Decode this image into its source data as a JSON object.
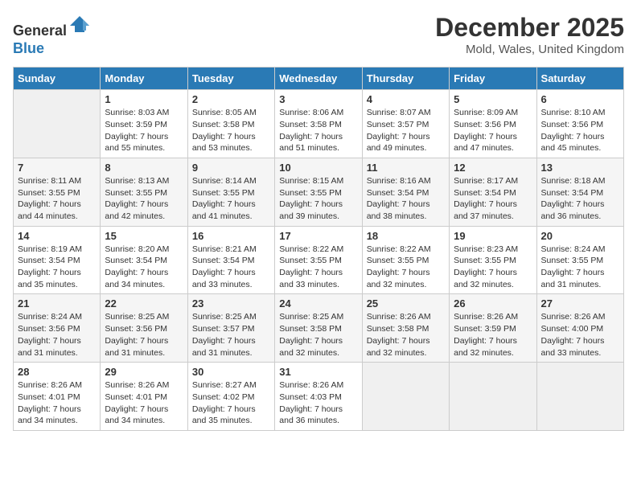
{
  "logo": {
    "general": "General",
    "blue": "Blue"
  },
  "header": {
    "month": "December 2025",
    "location": "Mold, Wales, United Kingdom"
  },
  "days_of_week": [
    "Sunday",
    "Monday",
    "Tuesday",
    "Wednesday",
    "Thursday",
    "Friday",
    "Saturday"
  ],
  "weeks": [
    [
      {
        "day": "",
        "info": ""
      },
      {
        "day": "1",
        "info": "Sunrise: 8:03 AM\nSunset: 3:59 PM\nDaylight: 7 hours\nand 55 minutes."
      },
      {
        "day": "2",
        "info": "Sunrise: 8:05 AM\nSunset: 3:58 PM\nDaylight: 7 hours\nand 53 minutes."
      },
      {
        "day": "3",
        "info": "Sunrise: 8:06 AM\nSunset: 3:58 PM\nDaylight: 7 hours\nand 51 minutes."
      },
      {
        "day": "4",
        "info": "Sunrise: 8:07 AM\nSunset: 3:57 PM\nDaylight: 7 hours\nand 49 minutes."
      },
      {
        "day": "5",
        "info": "Sunrise: 8:09 AM\nSunset: 3:56 PM\nDaylight: 7 hours\nand 47 minutes."
      },
      {
        "day": "6",
        "info": "Sunrise: 8:10 AM\nSunset: 3:56 PM\nDaylight: 7 hours\nand 45 minutes."
      }
    ],
    [
      {
        "day": "7",
        "info": "Sunrise: 8:11 AM\nSunset: 3:55 PM\nDaylight: 7 hours\nand 44 minutes."
      },
      {
        "day": "8",
        "info": "Sunrise: 8:13 AM\nSunset: 3:55 PM\nDaylight: 7 hours\nand 42 minutes."
      },
      {
        "day": "9",
        "info": "Sunrise: 8:14 AM\nSunset: 3:55 PM\nDaylight: 7 hours\nand 41 minutes."
      },
      {
        "day": "10",
        "info": "Sunrise: 8:15 AM\nSunset: 3:55 PM\nDaylight: 7 hours\nand 39 minutes."
      },
      {
        "day": "11",
        "info": "Sunrise: 8:16 AM\nSunset: 3:54 PM\nDaylight: 7 hours\nand 38 minutes."
      },
      {
        "day": "12",
        "info": "Sunrise: 8:17 AM\nSunset: 3:54 PM\nDaylight: 7 hours\nand 37 minutes."
      },
      {
        "day": "13",
        "info": "Sunrise: 8:18 AM\nSunset: 3:54 PM\nDaylight: 7 hours\nand 36 minutes."
      }
    ],
    [
      {
        "day": "14",
        "info": "Sunrise: 8:19 AM\nSunset: 3:54 PM\nDaylight: 7 hours\nand 35 minutes."
      },
      {
        "day": "15",
        "info": "Sunrise: 8:20 AM\nSunset: 3:54 PM\nDaylight: 7 hours\nand 34 minutes."
      },
      {
        "day": "16",
        "info": "Sunrise: 8:21 AM\nSunset: 3:54 PM\nDaylight: 7 hours\nand 33 minutes."
      },
      {
        "day": "17",
        "info": "Sunrise: 8:22 AM\nSunset: 3:55 PM\nDaylight: 7 hours\nand 33 minutes."
      },
      {
        "day": "18",
        "info": "Sunrise: 8:22 AM\nSunset: 3:55 PM\nDaylight: 7 hours\nand 32 minutes."
      },
      {
        "day": "19",
        "info": "Sunrise: 8:23 AM\nSunset: 3:55 PM\nDaylight: 7 hours\nand 32 minutes."
      },
      {
        "day": "20",
        "info": "Sunrise: 8:24 AM\nSunset: 3:55 PM\nDaylight: 7 hours\nand 31 minutes."
      }
    ],
    [
      {
        "day": "21",
        "info": "Sunrise: 8:24 AM\nSunset: 3:56 PM\nDaylight: 7 hours\nand 31 minutes."
      },
      {
        "day": "22",
        "info": "Sunrise: 8:25 AM\nSunset: 3:56 PM\nDaylight: 7 hours\nand 31 minutes."
      },
      {
        "day": "23",
        "info": "Sunrise: 8:25 AM\nSunset: 3:57 PM\nDaylight: 7 hours\nand 31 minutes."
      },
      {
        "day": "24",
        "info": "Sunrise: 8:25 AM\nSunset: 3:58 PM\nDaylight: 7 hours\nand 32 minutes."
      },
      {
        "day": "25",
        "info": "Sunrise: 8:26 AM\nSunset: 3:58 PM\nDaylight: 7 hours\nand 32 minutes."
      },
      {
        "day": "26",
        "info": "Sunrise: 8:26 AM\nSunset: 3:59 PM\nDaylight: 7 hours\nand 32 minutes."
      },
      {
        "day": "27",
        "info": "Sunrise: 8:26 AM\nSunset: 4:00 PM\nDaylight: 7 hours\nand 33 minutes."
      }
    ],
    [
      {
        "day": "28",
        "info": "Sunrise: 8:26 AM\nSunset: 4:01 PM\nDaylight: 7 hours\nand 34 minutes."
      },
      {
        "day": "29",
        "info": "Sunrise: 8:26 AM\nSunset: 4:01 PM\nDaylight: 7 hours\nand 34 minutes."
      },
      {
        "day": "30",
        "info": "Sunrise: 8:27 AM\nSunset: 4:02 PM\nDaylight: 7 hours\nand 35 minutes."
      },
      {
        "day": "31",
        "info": "Sunrise: 8:26 AM\nSunset: 4:03 PM\nDaylight: 7 hours\nand 36 minutes."
      },
      {
        "day": "",
        "info": ""
      },
      {
        "day": "",
        "info": ""
      },
      {
        "day": "",
        "info": ""
      }
    ]
  ]
}
